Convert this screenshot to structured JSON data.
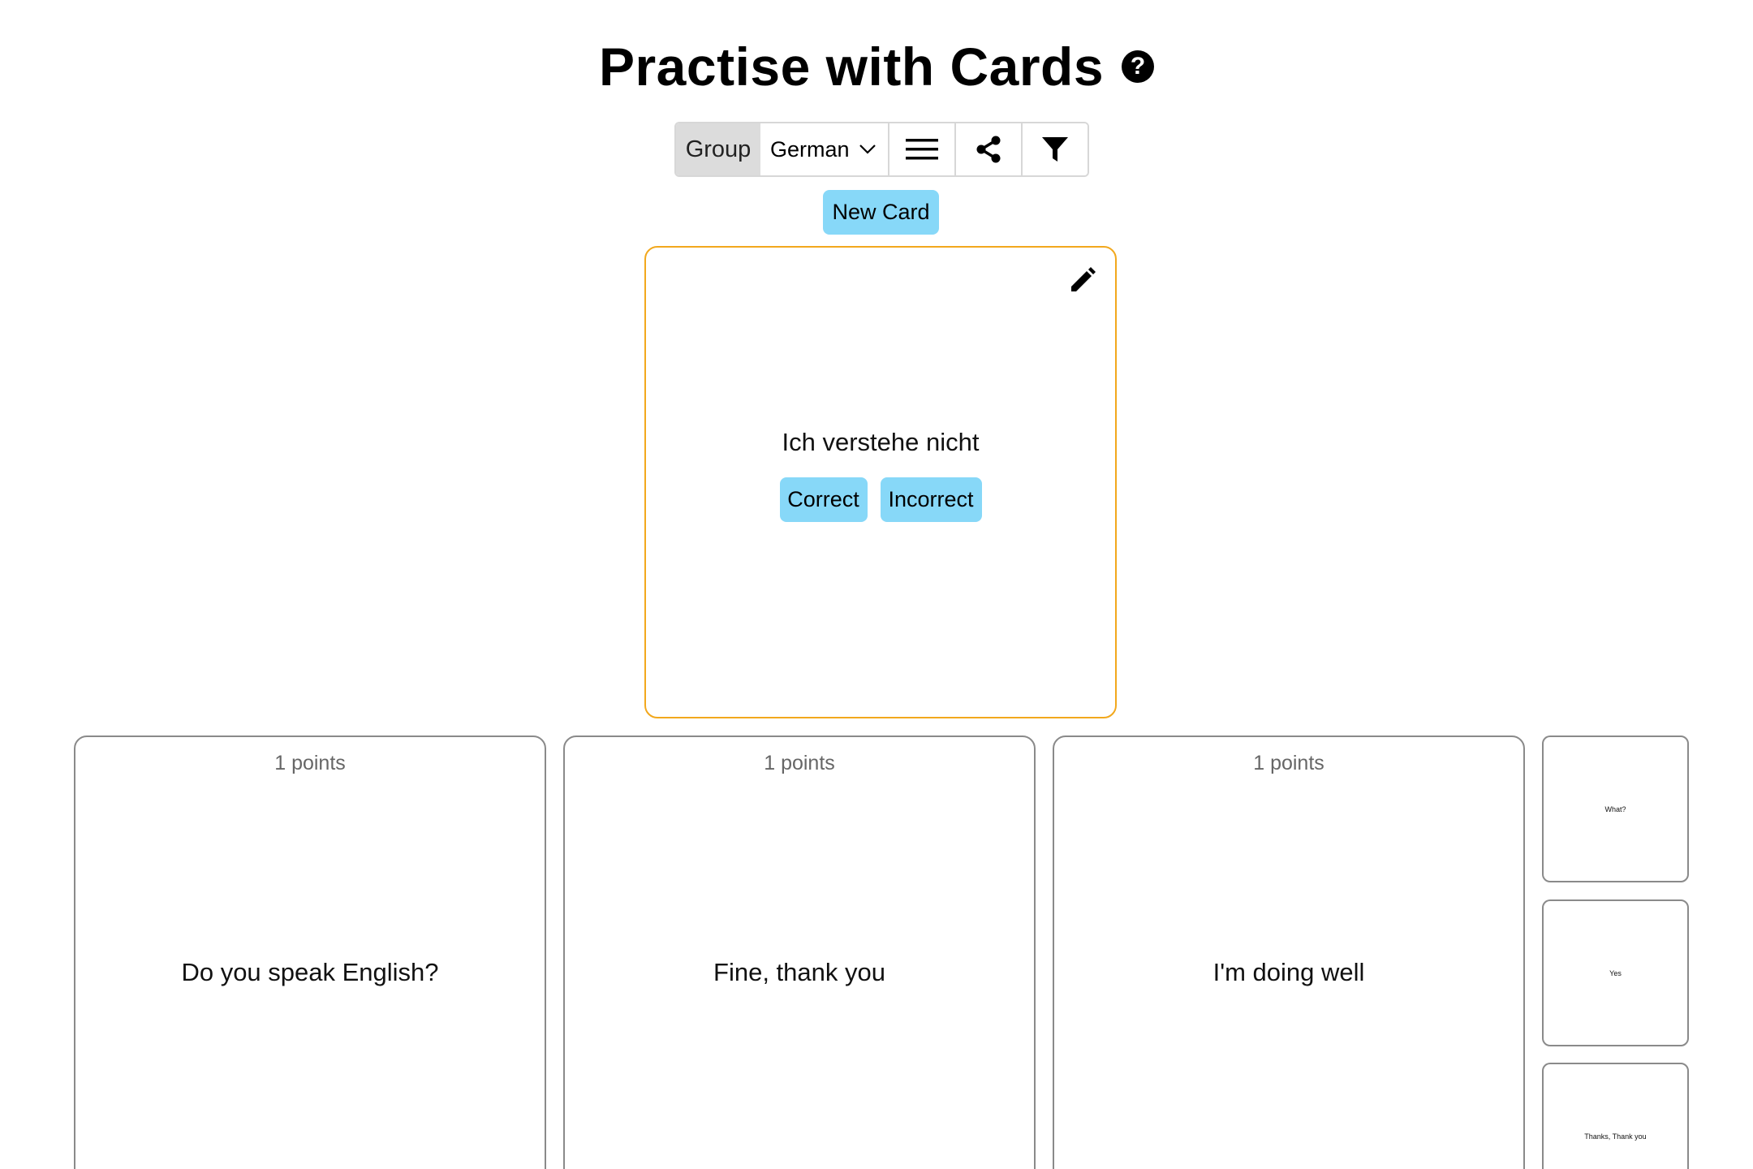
{
  "header": {
    "title": "Practise with Cards",
    "help_icon": "question-circle-icon"
  },
  "toolbar": {
    "group_label": "Group",
    "group_selected": "German",
    "list_icon": "menu-icon",
    "share_icon": "share-icon",
    "filter_icon": "filter-icon"
  },
  "actions": {
    "new_card_label": "New Card"
  },
  "current_card": {
    "text": "Ich verstehe nicht",
    "correct_label": "Correct",
    "incorrect_label": "Incorrect",
    "edit_icon": "pencil-icon"
  },
  "deck": {
    "cards": [
      {
        "points": "1 points",
        "text": "Do you speak English?"
      },
      {
        "points": "1 points",
        "text": "Fine, thank you"
      },
      {
        "points": "1 points",
        "text": "I'm doing well"
      }
    ],
    "thumbnails": [
      {
        "text": "What?"
      },
      {
        "text": "Yes"
      },
      {
        "text": "Thanks, Thank you"
      }
    ]
  },
  "colors": {
    "accent_button": "#87d8f8",
    "active_card_border": "#f2a81d",
    "card_border": "#8a8a8a"
  }
}
